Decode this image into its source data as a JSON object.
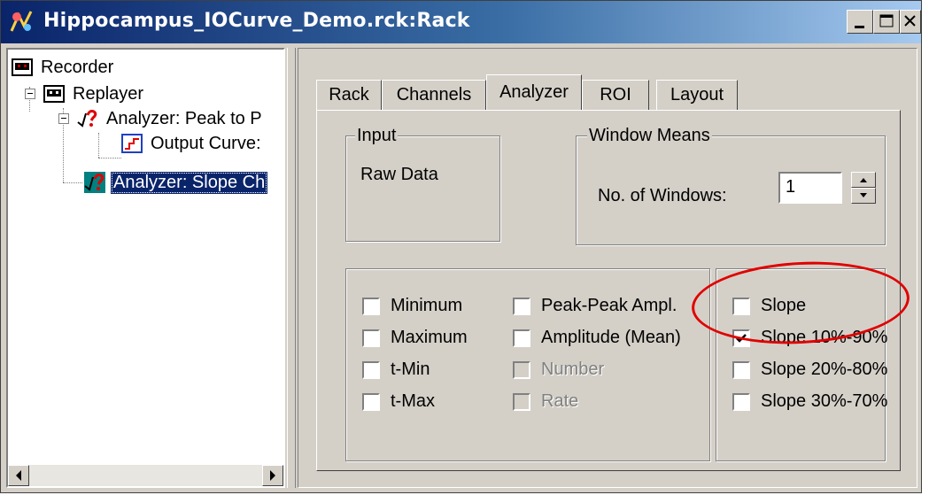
{
  "window": {
    "title": "Hippocampus_IOCurve_Demo.rck:Rack",
    "buttons": [
      "minimize",
      "maximize",
      "close"
    ]
  },
  "tree": {
    "items": [
      {
        "label": "Recorder",
        "icon": "recorder-icon",
        "selected": false
      },
      {
        "label": "Replayer",
        "icon": "replayer-icon",
        "selected": false,
        "expanded": true
      },
      {
        "label": "Analyzer: Peak to P",
        "icon": "analyzer-icon",
        "selected": false,
        "expanded": true
      },
      {
        "label": "Output Curve:",
        "icon": "output-curve-icon",
        "selected": false
      },
      {
        "label": "Analyzer: Slope Ch",
        "icon": "analyzer-icon",
        "selected": true
      }
    ]
  },
  "tabs": [
    {
      "label": "Rack",
      "active": false
    },
    {
      "label": "Channels",
      "active": false
    },
    {
      "label": "Analyzer",
      "active": true
    },
    {
      "label": "ROI",
      "active": false
    },
    {
      "label": "Layout",
      "active": false
    }
  ],
  "input_group": {
    "legend": "Input",
    "value": "Raw Data"
  },
  "window_means": {
    "legend": "Window Means",
    "label": "No. of Windows:",
    "value": "1"
  },
  "measures_left": [
    {
      "label": "Minimum",
      "checked": false,
      "enabled": true
    },
    {
      "label": "Maximum",
      "checked": false,
      "enabled": true
    },
    {
      "label": "t-Min",
      "checked": false,
      "enabled": true
    },
    {
      "label": "t-Max",
      "checked": false,
      "enabled": true
    }
  ],
  "measures_mid": [
    {
      "label": "Peak-Peak Ampl.",
      "checked": false,
      "enabled": true
    },
    {
      "label": "Amplitude (Mean)",
      "checked": false,
      "enabled": true
    },
    {
      "label": "Number",
      "checked": false,
      "enabled": false
    },
    {
      "label": "Rate",
      "checked": false,
      "enabled": false
    }
  ],
  "measures_slope": [
    {
      "label": "Slope",
      "checked": false,
      "enabled": true
    },
    {
      "label": "Slope 10%-90%",
      "checked": true,
      "enabled": true
    },
    {
      "label": "Slope 20%-80%",
      "checked": false,
      "enabled": true
    },
    {
      "label": "Slope 30%-70%",
      "checked": false,
      "enabled": true
    }
  ],
  "colors": {
    "annotation": "#e00000",
    "selection": "#0a246a",
    "titlebar": "#0a246a"
  }
}
